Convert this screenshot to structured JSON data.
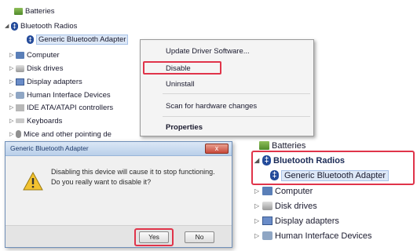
{
  "tree_left": [
    {
      "label": "Batteries",
      "icon": "battery-icon"
    },
    {
      "label": "Bluetooth Radios",
      "icon": "bluetooth-icon",
      "expanded": true
    },
    {
      "label": "Generic Bluetooth Adapter",
      "icon": "bluetooth-icon",
      "selected": true
    },
    {
      "label": "Computer",
      "icon": "computer-icon"
    },
    {
      "label": "Disk drives",
      "icon": "disk-icon"
    },
    {
      "label": "Display adapters",
      "icon": "display-icon"
    },
    {
      "label": "Human Interface Devices",
      "icon": "hid-icon"
    },
    {
      "label": "IDE ATA/ATAPI controllers",
      "icon": "ide-icon"
    },
    {
      "label": "Keyboards",
      "icon": "keyboard-icon"
    },
    {
      "label": "Mice and other pointing de",
      "icon": "mouse-icon"
    }
  ],
  "context_menu": {
    "update": "Update Driver Software...",
    "disable": "Disable",
    "uninstall": "Uninstall",
    "scan": "Scan for hardware changes",
    "properties": "Properties"
  },
  "dialog": {
    "title": "Generic Bluetooth Adapter",
    "close": "x",
    "message": "Disabling this device will cause it to stop functioning. Do you really want to disable it?",
    "yes": "Yes",
    "no": "No"
  },
  "tree_right": [
    {
      "label": "Batteries",
      "icon": "battery-icon"
    },
    {
      "label": "Bluetooth Radios",
      "icon": "bluetooth-icon"
    },
    {
      "label": "Generic Bluetooth Adapter",
      "icon": "bluetooth-icon",
      "selected": true
    },
    {
      "label": "Computer",
      "icon": "computer-icon"
    },
    {
      "label": "Disk drives",
      "icon": "disk-icon"
    },
    {
      "label": "Display adapters",
      "icon": "display-icon"
    },
    {
      "label": "Human Interface Devices",
      "icon": "hid-icon"
    }
  ],
  "colors": {
    "highlight": "#e0344a",
    "selection": "#dde8f7"
  }
}
